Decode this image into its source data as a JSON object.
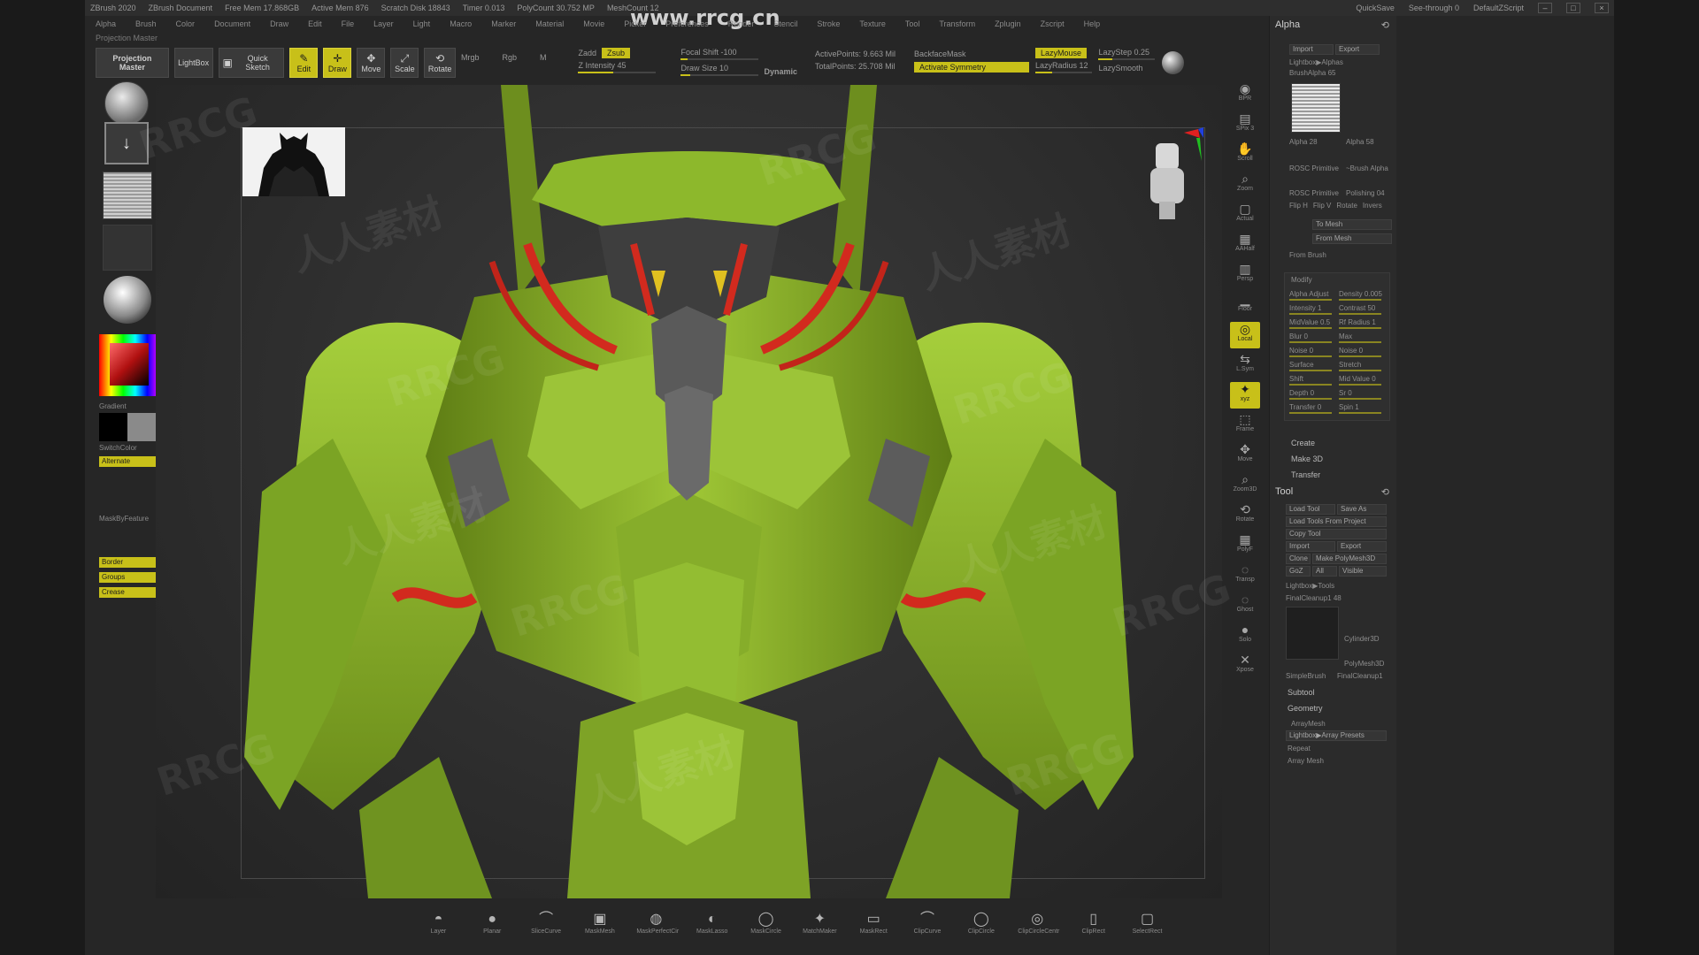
{
  "watermark": {
    "site": "www.rrcg.cn",
    "logo": "RRCG",
    "cn": "人人素材"
  },
  "titlebar": {
    "items": [
      "ZBrush 2020",
      "ZBrush Document",
      "Free Mem 17.868GB",
      "Active Mem 876",
      "Scratch Disk 18843",
      "Timer 0.013",
      "PolyCount 30.752 MP",
      "MeshCount 12"
    ],
    "right": [
      "QuickSave",
      "See-through 0",
      "DefaultZScript"
    ]
  },
  "menubar": [
    "Alpha",
    "Brush",
    "Color",
    "Document",
    "Draw",
    "Edit",
    "File",
    "Layer",
    "Light",
    "Macro",
    "Marker",
    "Material",
    "Movie",
    "Picker",
    "Preferences",
    "Render",
    "Stencil",
    "Stroke",
    "Texture",
    "Tool",
    "Transform",
    "Zplugin",
    "Zscript",
    "Help"
  ],
  "subbar": "Projection Master",
  "shelf": {
    "projection_master": "Projection Master",
    "lightbox": "LightBox",
    "quick_sketch": "Quick Sketch",
    "edit": "Edit",
    "draw": "Draw",
    "move": "Move",
    "scale": "Scale",
    "rotate": "Rotate",
    "mrgb": "Mrgb",
    "rgb": "Rgb",
    "m": "M",
    "zadd": "Zadd",
    "zsub": "Zsub",
    "z_intensity": "Z Intensity 45",
    "focal_shift": "Focal Shift -100",
    "draw_size": "Draw Size 10",
    "dynamic": "Dynamic",
    "active_points": "ActivePoints: 9.663 Mil",
    "total_points": "TotalPoints: 25.708 Mil",
    "backface_mask": "BackfaceMask",
    "activate_symmetry": "Activate Symmetry",
    "lazy_mouse": "LazyMouse",
    "lazy_step": "LazyStep 0.25",
    "lazy_radius": "LazyRadius 12",
    "lazy_smooth": "LazySmooth"
  },
  "left": {
    "gradient": "Gradient",
    "switch_color": "SwitchColor",
    "alternate": "Alternate",
    "mask_by_feature": "MaskByFeature",
    "border": "Border",
    "groups": "Groups",
    "crease": "Crease"
  },
  "rightcol": [
    "BPR",
    "SPix 3",
    "Scroll",
    "Zoom",
    "Actual",
    "AAHalf",
    "Persp",
    "Floor",
    "Local",
    "L.Sym",
    "xyz",
    "Frame",
    "Move",
    "Zoom3D",
    "Rotate",
    "PolyF",
    "Transp",
    "Ghost",
    "Solo",
    "Xpose"
  ],
  "alpha_palette": {
    "title": "Alpha",
    "import": "Import",
    "export": "Export",
    "lightbox_alphas": "Lightbox▶Alphas",
    "brush_alpha": "BrushAlpha 65",
    "alpha_labels": [
      "Alpha 28",
      "Alpha 58",
      "ROSC Primitive",
      "~Brush Alpha",
      "ROSC Primitive",
      "Polishing 04"
    ],
    "tools": [
      "Flip H",
      "Flip V",
      "Rotate",
      "Invers"
    ],
    "to_mesh": "To Mesh",
    "from_mesh": "From Mesh",
    "from_brush": "From Brush",
    "modify": "Modify",
    "rows": [
      "Alpha Adjust",
      "Density 0.005",
      "Intensity 1",
      "Contrast 50",
      "MidValue 0.5",
      "Rf Radius 1",
      "Blur 0",
      "Max",
      "Noise 0",
      "Noise 0",
      "Surface",
      "Stretch",
      "Shift",
      "Mid Value 0",
      "Depth 0",
      "Sr 0",
      "Transfer 0",
      "Spin 1"
    ],
    "create": "Create",
    "make_3d": "Make 3D",
    "transfer": "Transfer"
  },
  "tool_palette": {
    "title": "Tool",
    "load_tool": "Load Tool",
    "save_as": "Save As",
    "load_from_project": "Load Tools From Project",
    "copy_tool": "Copy Tool",
    "import": "Import",
    "export": "Export",
    "clone": "Clone",
    "make_polymesh": "Make PolyMesh3D",
    "goz": "GoZ",
    "all": "All",
    "visible": "Visible",
    "lightbox_tools": "Lightbox▶Tools",
    "final_cleanup": "FinalCleanup1 48",
    "thumbs": [
      "Cylinder3D",
      "PolyMesh3D",
      "SimpleBrush",
      "FinalCleanup1"
    ],
    "subtool": "Subtool",
    "geometry": "Geometry",
    "array_mesh": "ArrayMesh",
    "lightbox_array": "Lightbox▶Array Presets",
    "repeat": "Repeat",
    "array_mesh2": "Array Mesh"
  },
  "bottom_shelf": [
    "Layer",
    "Planar",
    "SliceCurve",
    "MaskMesh",
    "MaskPerfectCir",
    "MaskLasso",
    "MaskCircle",
    "MatchMaker",
    "MaskRect",
    "ClipCurve",
    "ClipCircle",
    "ClipCircleCentr",
    "ClipRect",
    "SelectRect"
  ],
  "colors": {
    "accent": "#c8c019",
    "model_green": "#8fb82a",
    "model_red": "#d22a1e"
  }
}
